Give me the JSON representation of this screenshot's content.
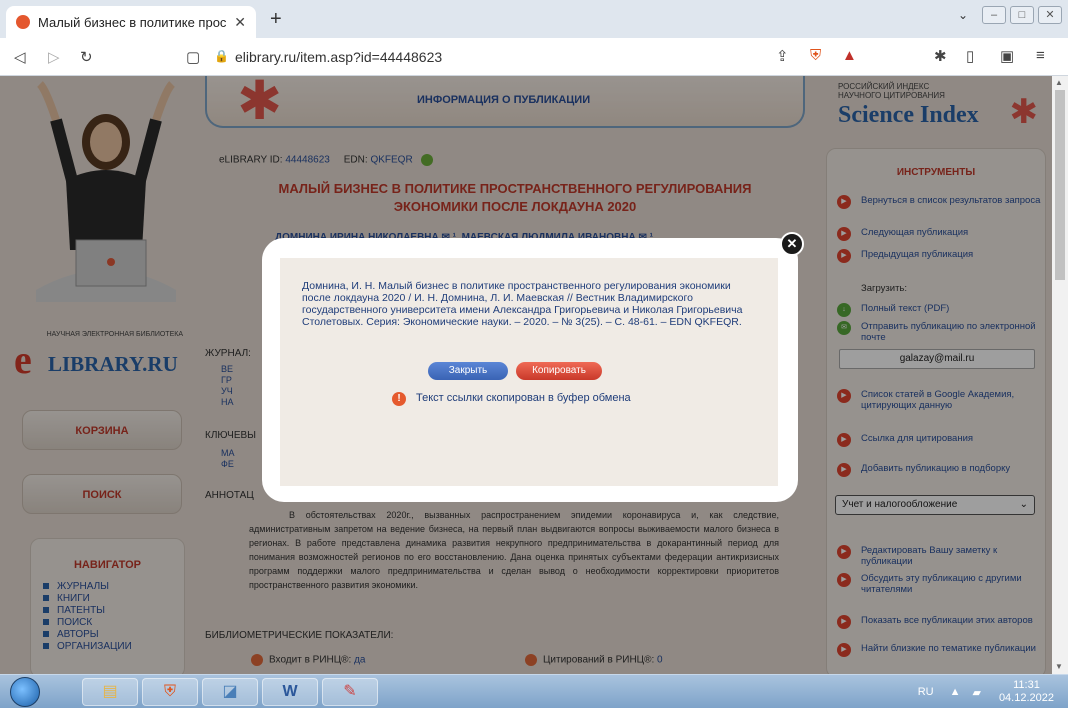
{
  "browser": {
    "tab_title": "Малый бизнес в политике простр",
    "url": "elibrary.ru/item.asp?id=44448623"
  },
  "left": {
    "logo_small": "НАУЧНАЯ ЭЛЕКТРОННАЯ БИБЛИОТЕКА",
    "logo_big": "LIBRARY.RU",
    "logo_e": "e",
    "cart": "КОРЗИНА",
    "search": "ПОИСК",
    "nav_title": "НАВИГАТОР",
    "nav_items": [
      "ЖУРНАЛЫ",
      "КНИГИ",
      "ПАТЕНТЫ",
      "ПОИСК",
      "АВТОРЫ",
      "ОРГАНИЗАЦИИ"
    ]
  },
  "banner": {
    "title": "ИНФОРМАЦИЯ О ПУБЛИКАЦИИ"
  },
  "item": {
    "id_label": "eLIBRARY ID:",
    "id_value": "44448623",
    "edn_label": "EDN:",
    "edn_value": "QKFEQR",
    "title": "МАЛЫЙ БИЗНЕС В ПОЛИТИКЕ ПРОСТРАНСТВЕННОГО РЕГУЛИРОВАНИЯ ЭКОНОМИКИ ПОСЛЕ ЛОКДАУНА 2020",
    "authors": "ДОМНИНА ИРИНА НИКОЛАЕВНА ✉ ¹, МАЕВСКАЯ ЛЮДМИЛА ИВАНОВНА ✉ ¹",
    "journal_label": "ЖУРНАЛ:",
    "journal_lines": [
      "ВЕ",
      "ГР",
      "УЧ",
      "НА"
    ],
    "keywords_label": "КЛЮЧЕВЫ",
    "keywords_lines": [
      "МА",
      "ФЕ"
    ],
    "abstract_label": "АННОТАЦ",
    "abstract": "В обстоятельствах 2020г., вызванных распространением эпидемии коронавируса и, как следствие, административным запретом на ведение бизнеса, на первый план выдвигаются вопросы выживаемости малого бизнеса в регионах. В работе представлена динамика развития некрупного предпринимательства в докарантинный период для понимания возможностей регионов по его восстановлению. Дана оценка принятых субъектами федерации антикризисных программ поддержки малого предпринимательства и сделан вывод о необходимости корректировки приоритетов пространственного развития экономики.",
    "biblio_label": "БИБЛИОМЕТРИЧЕСКИЕ ПОКАЗАТЕЛИ:",
    "rinc_label": "Входит в РИНЦ®:",
    "rinc_value": "да",
    "cited_label": "Цитирований в РИНЦ®:",
    "cited_value": "0"
  },
  "right": {
    "si_line1": "РОССИЙСКИЙ ИНДЕКС",
    "si_line2": "НАУЧНОГО ЦИТИРОВАНИЯ",
    "si_big": "Science Index",
    "tools_title": "ИНСТРУМЕНТЫ",
    "back": "Вернуться в список результатов запроса",
    "next": "Следующая публикация",
    "prev": "Предыдущая публикация",
    "download_label": "Загрузить:",
    "fulltext": "Полный текст (PDF)",
    "send_email": "Отправить публикацию по электронной почте",
    "email": "galazay@mail.ru",
    "google": "Список статей в Google Академия, цитирующих данную",
    "cite_link": "Ссылка для цитирования",
    "add_collection": "Добавить публикацию в подборку",
    "collection_select": "Учет и налогообложение",
    "edit_note": "Редактировать Вашу заметку к публикации",
    "discuss": "Обсудить эту публикацию с другими читателями",
    "show_all": "Показать все публикации этих авторов",
    "similar": "Найти близкие по тематике публикации"
  },
  "modal": {
    "citation": "Домнина, И. Н. Малый бизнес в политике пространственного регулирования экономики после локдауна 2020 / И. Н. Домнина, Л. И. Маевская // Вестник Владимирского государственного университета имени Александра Григорьевича и Николая Григорьевича Столетовых. Серия: Экономические науки. – 2020. – № 3(25). – С. 48-61. – EDN QKFEQR.",
    "close_label": "Закрыть",
    "copy_label": "Копировать",
    "note": "Текст ссылки скопирован в буфер обмена"
  },
  "taskbar": {
    "lang": "RU",
    "time": "11:31",
    "date": "04.12.2022"
  }
}
